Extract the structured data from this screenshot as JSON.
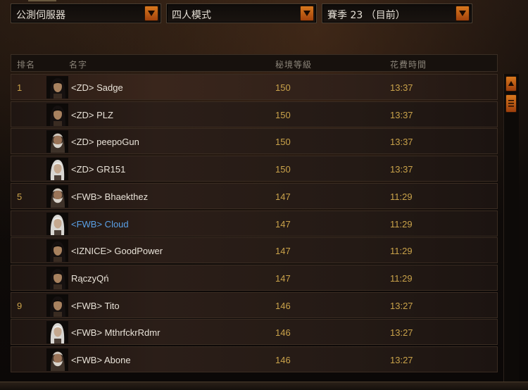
{
  "filters": {
    "server": "公測伺服器",
    "mode": "四人模式",
    "season": "賽季 23 （目前）"
  },
  "table": {
    "columns": {
      "rank": "排名",
      "name": "名字",
      "level": "秘境等級",
      "time": "花費時間"
    },
    "rows": [
      {
        "rank": "1",
        "name": "<ZD> Sadge",
        "level": "150",
        "time": "13:37",
        "portrait": "dark-hair-female"
      },
      {
        "rank": "",
        "name": "<ZD> PLZ",
        "level": "150",
        "time": "13:37",
        "portrait": "dark-hair-female"
      },
      {
        "rank": "",
        "name": "<ZD> peepoGun",
        "level": "150",
        "time": "13:37",
        "portrait": "bearded-male"
      },
      {
        "rank": "",
        "name": "<ZD> GR151",
        "level": "150",
        "time": "13:37",
        "portrait": "white-hair-female"
      },
      {
        "rank": "5",
        "name": "<FWB> Bhaekthez",
        "level": "147",
        "time": "11:29",
        "portrait": "bearded-male"
      },
      {
        "rank": "",
        "name": "<FWB> Cloud",
        "level": "147",
        "time": "11:29",
        "portrait": "white-hair-female",
        "highlight": true
      },
      {
        "rank": "",
        "name": "<IZNICE> GoodPower",
        "level": "147",
        "time": "11:29",
        "portrait": "dark-hair-female"
      },
      {
        "rank": "",
        "name": "RączyQń",
        "level": "147",
        "time": "11:29",
        "portrait": "dark-hair-female"
      },
      {
        "rank": "9",
        "name": "<FWB> Tito",
        "level": "146",
        "time": "13:27",
        "portrait": "dark-hair-female"
      },
      {
        "rank": "",
        "name": "<FWB> MthrfckrRdmr",
        "level": "146",
        "time": "13:27",
        "portrait": "white-hair-female"
      },
      {
        "rank": "",
        "name": "<FWB> Abone",
        "level": "146",
        "time": "13:27",
        "portrait": "bearded-male"
      }
    ]
  },
  "icons": {
    "dropdown_arrow": "chevron-down-icon",
    "scroll_up": "arrow-up-icon",
    "scroll_thumb": "grip-icon"
  },
  "colors": {
    "accent": "#c9a24a",
    "highlight_name": "#5aa0e6",
    "button_orange": "#d8781e"
  }
}
